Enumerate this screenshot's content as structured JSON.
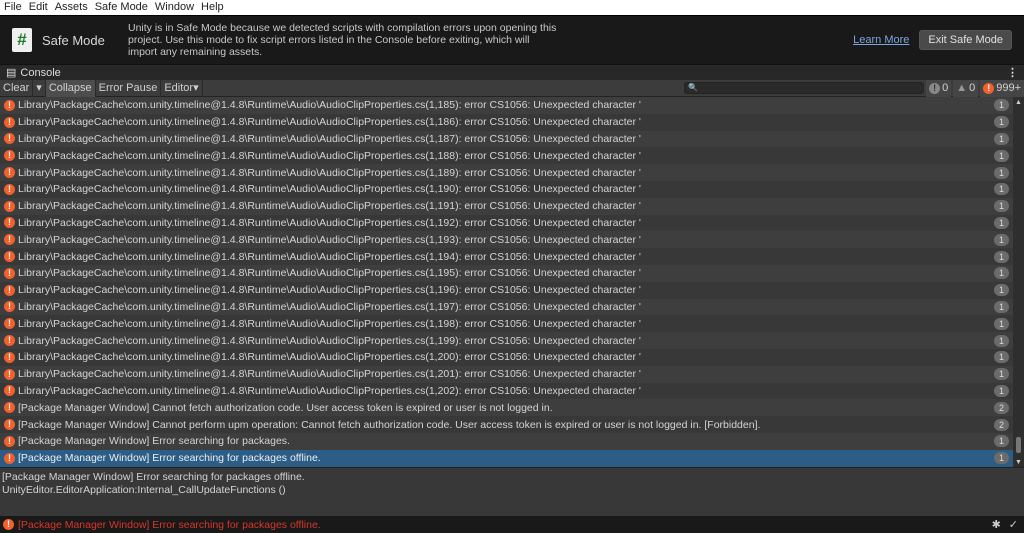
{
  "menu": [
    "File",
    "Edit",
    "Assets",
    "Safe Mode",
    "Window",
    "Help"
  ],
  "banner": {
    "title": "Safe Mode",
    "icon_glyph": "#",
    "text": "Unity is in Safe Mode because we detected scripts with compilation errors upon opening this project. Use this mode to fix script errors listed in the Console before exiting, which will import any remaining assets.",
    "learn_more": "Learn More",
    "exit": "Exit Safe Mode"
  },
  "console": {
    "tab": "Console",
    "toolbar": {
      "clear": "Clear",
      "collapse": "Collapse",
      "error_pause": "Error Pause",
      "editor": "Editor",
      "info_count": "0",
      "warn_count": "0",
      "error_count": "999+"
    },
    "rows": [
      {
        "msg": "Library\\PackageCache\\com.unity.timeline@1.4.8\\Runtime\\Audio\\AudioClipProperties.cs(1,185): error CS1056: Unexpected character '",
        "count": "1"
      },
      {
        "msg": "Library\\PackageCache\\com.unity.timeline@1.4.8\\Runtime\\Audio\\AudioClipProperties.cs(1,186): error CS1056: Unexpected character '",
        "count": "1"
      },
      {
        "msg": "Library\\PackageCache\\com.unity.timeline@1.4.8\\Runtime\\Audio\\AudioClipProperties.cs(1,187): error CS1056: Unexpected character '",
        "count": "1"
      },
      {
        "msg": "Library\\PackageCache\\com.unity.timeline@1.4.8\\Runtime\\Audio\\AudioClipProperties.cs(1,188): error CS1056: Unexpected character '",
        "count": "1"
      },
      {
        "msg": "Library\\PackageCache\\com.unity.timeline@1.4.8\\Runtime\\Audio\\AudioClipProperties.cs(1,189): error CS1056: Unexpected character '",
        "count": "1"
      },
      {
        "msg": "Library\\PackageCache\\com.unity.timeline@1.4.8\\Runtime\\Audio\\AudioClipProperties.cs(1,190): error CS1056: Unexpected character '",
        "count": "1"
      },
      {
        "msg": "Library\\PackageCache\\com.unity.timeline@1.4.8\\Runtime\\Audio\\AudioClipProperties.cs(1,191): error CS1056: Unexpected character '",
        "count": "1"
      },
      {
        "msg": "Library\\PackageCache\\com.unity.timeline@1.4.8\\Runtime\\Audio\\AudioClipProperties.cs(1,192): error CS1056: Unexpected character '",
        "count": "1"
      },
      {
        "msg": "Library\\PackageCache\\com.unity.timeline@1.4.8\\Runtime\\Audio\\AudioClipProperties.cs(1,193): error CS1056: Unexpected character '",
        "count": "1"
      },
      {
        "msg": "Library\\PackageCache\\com.unity.timeline@1.4.8\\Runtime\\Audio\\AudioClipProperties.cs(1,194): error CS1056: Unexpected character '",
        "count": "1"
      },
      {
        "msg": "Library\\PackageCache\\com.unity.timeline@1.4.8\\Runtime\\Audio\\AudioClipProperties.cs(1,195): error CS1056: Unexpected character '",
        "count": "1"
      },
      {
        "msg": "Library\\PackageCache\\com.unity.timeline@1.4.8\\Runtime\\Audio\\AudioClipProperties.cs(1,196): error CS1056: Unexpected character '",
        "count": "1"
      },
      {
        "msg": "Library\\PackageCache\\com.unity.timeline@1.4.8\\Runtime\\Audio\\AudioClipProperties.cs(1,197): error CS1056: Unexpected character '",
        "count": "1"
      },
      {
        "msg": "Library\\PackageCache\\com.unity.timeline@1.4.8\\Runtime\\Audio\\AudioClipProperties.cs(1,198): error CS1056: Unexpected character '",
        "count": "1"
      },
      {
        "msg": "Library\\PackageCache\\com.unity.timeline@1.4.8\\Runtime\\Audio\\AudioClipProperties.cs(1,199): error CS1056: Unexpected character '",
        "count": "1"
      },
      {
        "msg": "Library\\PackageCache\\com.unity.timeline@1.4.8\\Runtime\\Audio\\AudioClipProperties.cs(1,200): error CS1056: Unexpected character '",
        "count": "1"
      },
      {
        "msg": "Library\\PackageCache\\com.unity.timeline@1.4.8\\Runtime\\Audio\\AudioClipProperties.cs(1,201): error CS1056: Unexpected character '",
        "count": "1"
      },
      {
        "msg": "Library\\PackageCache\\com.unity.timeline@1.4.8\\Runtime\\Audio\\AudioClipProperties.cs(1,202): error CS1056: Unexpected character '",
        "count": "1"
      },
      {
        "msg": "[Package Manager Window] Cannot fetch authorization code. User access token is expired or user is not logged in.",
        "count": "2"
      },
      {
        "msg": "[Package Manager Window] Cannot perform upm operation: Cannot fetch authorization code. User access token is expired or user is not logged in. [Forbidden].",
        "count": "2"
      },
      {
        "msg": "[Package Manager Window] Error searching for packages.",
        "count": "1"
      },
      {
        "msg": "[Package Manager Window] Error searching for packages offline.",
        "count": "1",
        "selected": true
      }
    ],
    "detail": [
      "[Package Manager Window] Error searching for packages offline.",
      "UnityEditor.EditorApplication:Internal_CallUpdateFunctions ()"
    ]
  },
  "status": {
    "message": "[Package Manager Window] Error searching for packages offline."
  },
  "colors": {
    "error": "#f2602b",
    "selected": "#2c5d87",
    "status_error_text": "#d9362b"
  }
}
